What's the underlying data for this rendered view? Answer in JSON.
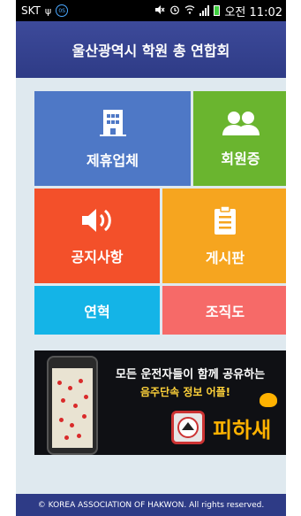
{
  "statusbar": {
    "carrier": "SKT",
    "badge": "0S",
    "time": "오전 11:02"
  },
  "header": {
    "title": "울산광역시 학원 총 연합회"
  },
  "menu": {
    "partner": "제휴업체",
    "member_card": "회원증",
    "notice": "공지사항",
    "board": "게시판",
    "history": "연혁",
    "organization": "조직도"
  },
  "banner": {
    "line1": "모든 운전자들이 함께 공유하는",
    "line2": "음주단속 정보 어플!",
    "brand": "피하새"
  },
  "footer": {
    "copyright": "© KOREA ASSOCIATION OF HAKWON. All rights reserved."
  }
}
